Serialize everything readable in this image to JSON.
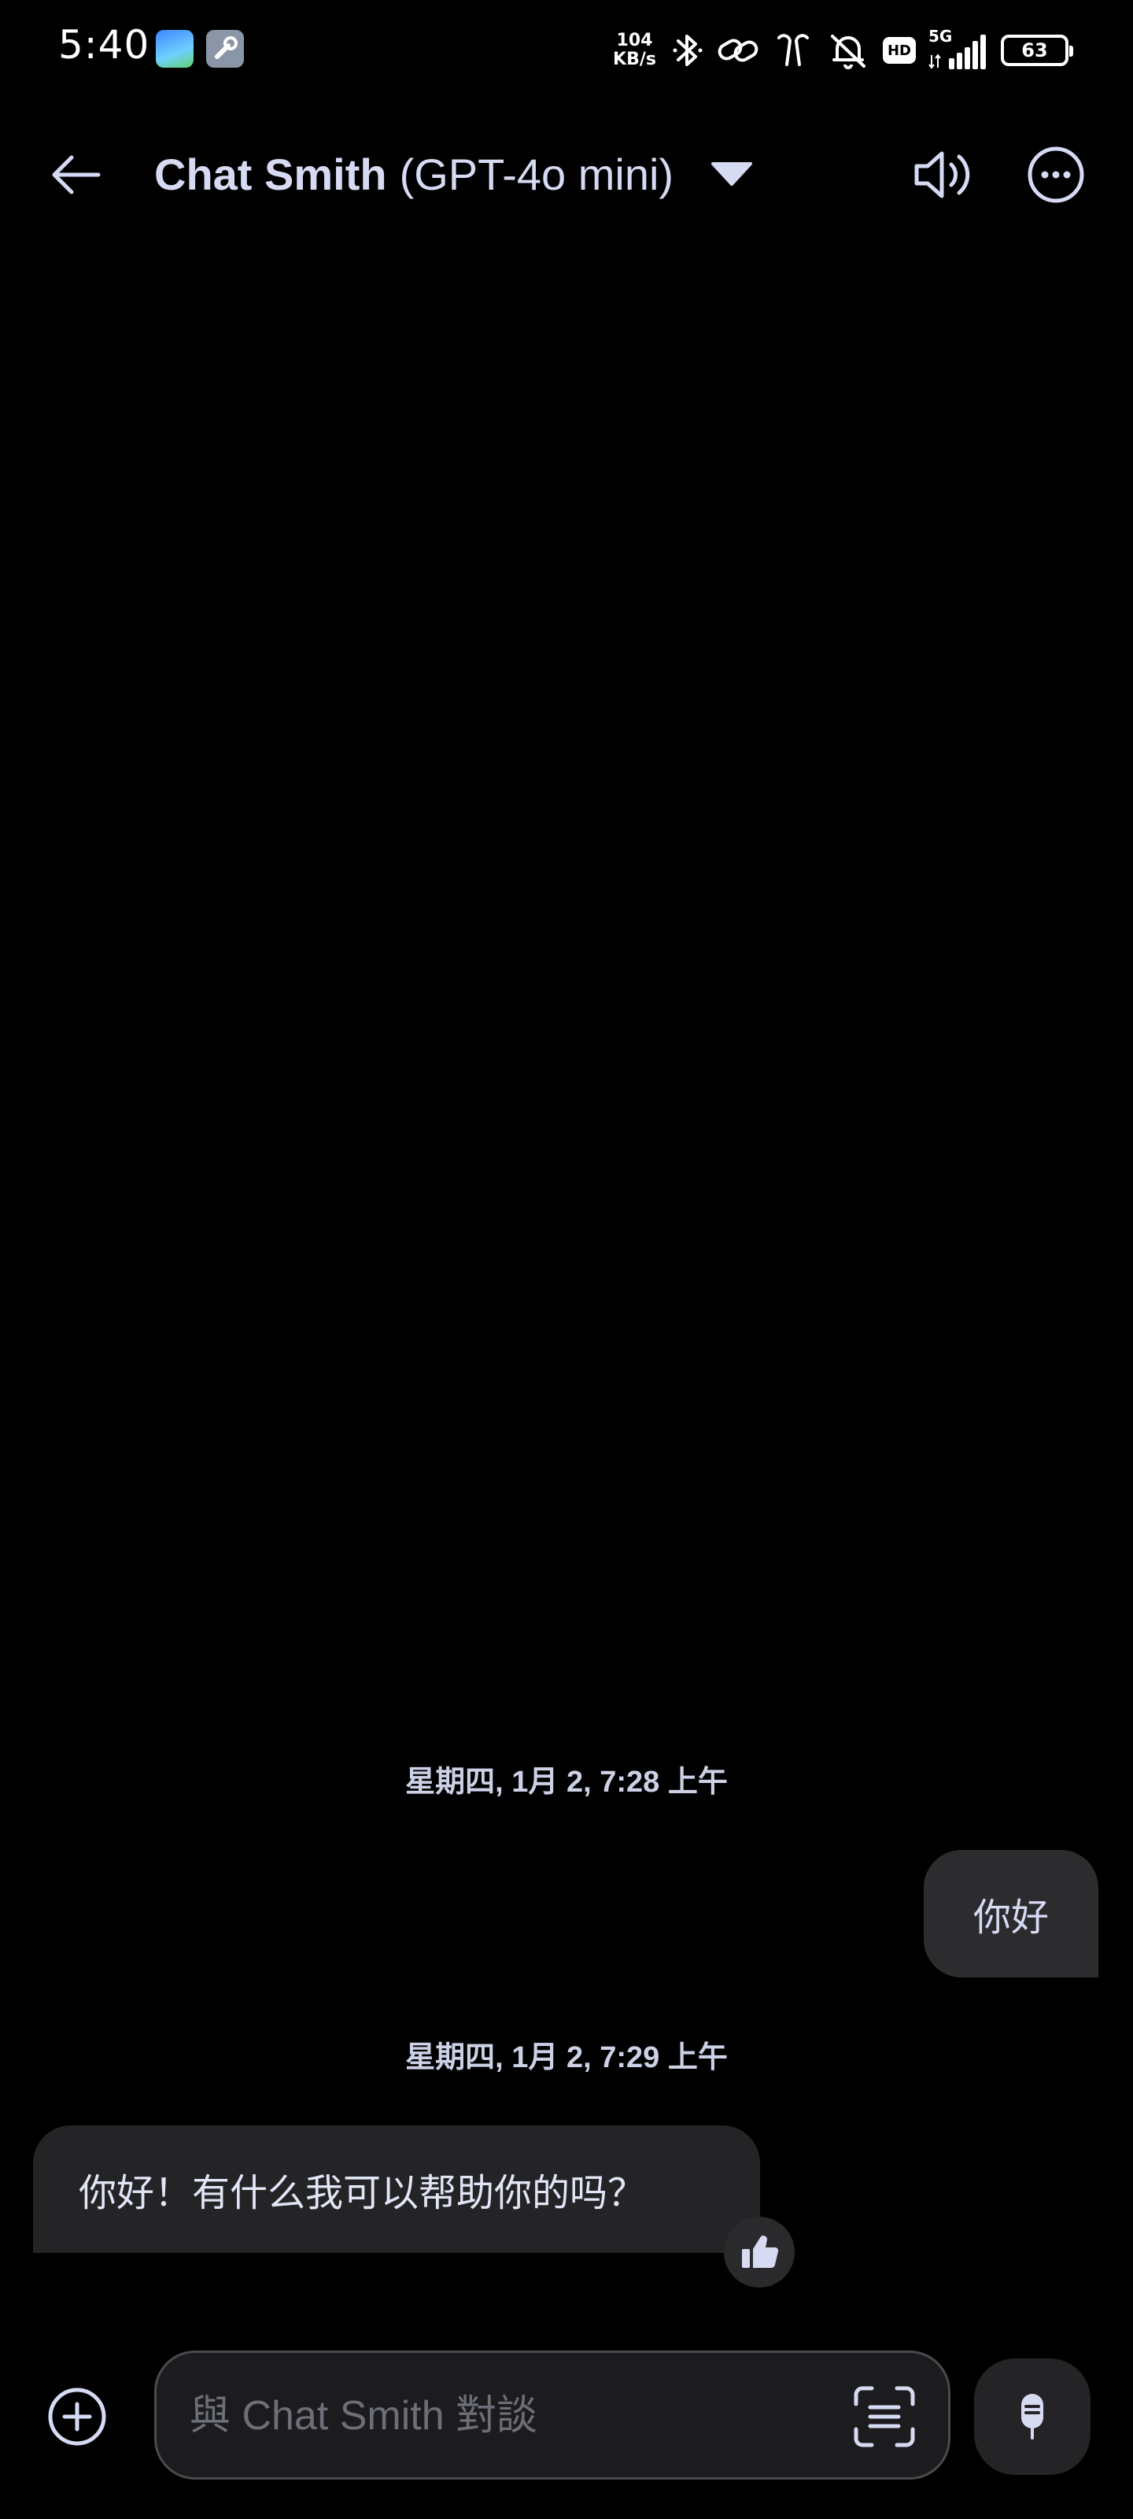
{
  "status_bar": {
    "time": "5:40",
    "net_speed_value": "104",
    "net_speed_unit": "KB/s",
    "hd_label": "HD",
    "network_type": "5G",
    "battery_level": "63",
    "icons": [
      "maps-app-icon",
      "tool-app-icon",
      "bluetooth-icon",
      "link-icon",
      "earbuds-icon",
      "mute-icon",
      "hd-icon",
      "signal-icon",
      "battery-icon"
    ]
  },
  "header": {
    "title_name": "Chat Smith",
    "title_model": "(GPT-4o mini)",
    "icons": [
      "back-arrow-icon",
      "caret-down-icon",
      "speaker-icon",
      "more-icon"
    ]
  },
  "conversation": {
    "messages": [
      {
        "timestamp": "星期四, 1月 2, 7:28 上午",
        "sender": "user",
        "text": "你好"
      },
      {
        "timestamp": "星期四, 1月 2, 7:29 上午",
        "sender": "bot",
        "text": "你好！有什么我可以帮助你的吗？"
      }
    ]
  },
  "composer": {
    "placeholder": "與 Chat Smith 對談",
    "value": "",
    "icons": [
      "plus-icon",
      "scan-text-icon",
      "mic-icon"
    ]
  },
  "colors": {
    "background": "#000000",
    "title_text": "#d6daf2",
    "user_bubble": "#2c2c2e",
    "bot_bubble": "#242426",
    "input_border": "#4a4a4e"
  }
}
